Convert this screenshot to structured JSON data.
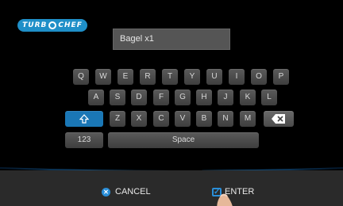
{
  "logo": {
    "brand_left": "TURB",
    "brand_right": "CHEF"
  },
  "entry": {
    "value": "Bagel x1"
  },
  "keyboard": {
    "row1": [
      "Q",
      "W",
      "E",
      "R",
      "T",
      "Y",
      "U",
      "I",
      "O",
      "P"
    ],
    "row2": [
      "A",
      "S",
      "D",
      "F",
      "G",
      "H",
      "J",
      "K",
      "L"
    ],
    "row3": [
      "Z",
      "X",
      "C",
      "V",
      "B",
      "N",
      "M"
    ],
    "numbers_label": "123",
    "space_label": "Space"
  },
  "bottom": {
    "cancel_label": "CANCEL",
    "enter_label": "ENTER"
  },
  "colors": {
    "accent": "#1a77b6",
    "logo": "#1f8fc8",
    "background": "#000000"
  },
  "icons": {
    "shift": "shift-arrow-icon",
    "backspace": "backspace-icon",
    "cancel": "x-circle-icon",
    "enter": "check-box-icon"
  }
}
